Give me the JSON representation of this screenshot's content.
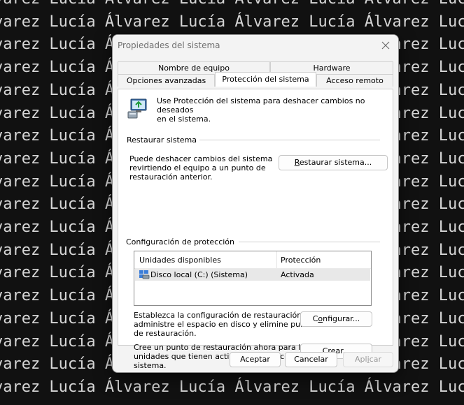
{
  "wallpaper": {
    "text": "Lucía Álvarez"
  },
  "dialog": {
    "title": "Propiedades del sistema",
    "tabs_back": [
      {
        "label": "Nombre de equipo"
      },
      {
        "label": "Hardware"
      }
    ],
    "tabs_front": [
      {
        "label": "Opciones avanzadas"
      },
      {
        "label": "Protección del sistema",
        "active": true
      },
      {
        "label": "Acceso remoto"
      }
    ],
    "intro_text_line1": "Use Protección del sistema para deshacer cambios no deseados",
    "intro_text_line2": "en el sistema.",
    "restore_section": {
      "label": "Restaurar sistema",
      "desc_line1": "Puede deshacer cambios del sistema",
      "desc_line2": "revirtiendo el equipo a un punto de",
      "desc_line3": "restauración anterior.",
      "button_pre": "R",
      "button_rest": "estaurar sistema..."
    },
    "protection_section": {
      "label": "Configuración de protección",
      "columns": [
        "Unidades disponibles",
        "Protección"
      ],
      "rows": [
        {
          "drive": "Disco local (C:) (Sistema)",
          "protection": "Activada"
        }
      ],
      "configure_desc_line1": "Establezca la configuración de restauración,",
      "configure_desc_line2": "administre el espacio en disco y elimine puntos",
      "configure_desc_line3": "de restauración.",
      "configure_pre": "C",
      "configure_u": "o",
      "configure_rest": "nfigurar...",
      "create_desc_line1": "Cree un punto de restauración ahora para las",
      "create_desc_line2": "unidades que tienen activada la protección del",
      "create_desc_line3": "sistema.",
      "create_pre": "Cr",
      "create_u": "e",
      "create_rest": "ar..."
    },
    "footer": {
      "ok": "Aceptar",
      "cancel": "Cancelar",
      "apply_pre": "Apl",
      "apply_u": "i",
      "apply_rest": "car"
    }
  }
}
